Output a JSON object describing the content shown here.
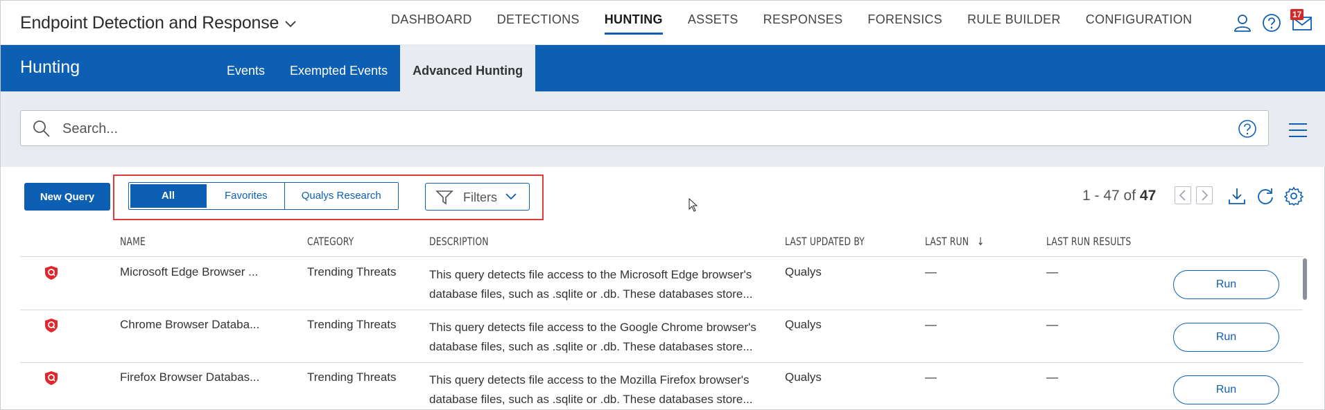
{
  "app": {
    "title": "Endpoint Detection and Response"
  },
  "nav": [
    {
      "label": "DASHBOARD",
      "active": false
    },
    {
      "label": "DETECTIONS",
      "active": false
    },
    {
      "label": "HUNTING",
      "active": true
    },
    {
      "label": "ASSETS",
      "active": false
    },
    {
      "label": "RESPONSES",
      "active": false
    },
    {
      "label": "FORENSICS",
      "active": false
    },
    {
      "label": "RULE BUILDER",
      "active": false
    },
    {
      "label": "CONFIGURATION",
      "active": false
    }
  ],
  "header_icons": {
    "user": "user-icon",
    "help": "help-icon",
    "mail": "mail-icon",
    "mail_badge": "17"
  },
  "section": {
    "title": "Hunting"
  },
  "subtabs": [
    {
      "label": "Events",
      "active": false
    },
    {
      "label": "Exempted Events",
      "active": false
    },
    {
      "label": "Advanced Hunting",
      "active": true
    }
  ],
  "search": {
    "placeholder": "Search...",
    "value": ""
  },
  "toolbar": {
    "new_query_label": "New Query",
    "segments": [
      {
        "label": "All",
        "active": true
      },
      {
        "label": "Favorites",
        "active": false
      },
      {
        "label": "Qualys Research",
        "active": false
      }
    ],
    "filters_label": "Filters"
  },
  "pagination": {
    "range": "1 - 47 of",
    "total": "47"
  },
  "table": {
    "headers": {
      "name": "NAME",
      "category": "CATEGORY",
      "description": "DESCRIPTION",
      "last_updated_by": "LAST UPDATED BY",
      "last_run": "LAST RUN",
      "last_run_results": "LAST RUN RESULTS"
    },
    "sort_indicator": "↓",
    "rows": [
      {
        "name": "Microsoft Edge Browser ...",
        "category": "Trending Threats",
        "desc1": "This query detects file access to the Microsoft Edge browser's",
        "desc2": "database files, such as .sqlite or .db. These databases store...",
        "last_updated_by": "Qualys",
        "last_run": "—",
        "last_run_results": "—",
        "action": "Run"
      },
      {
        "name": "Chrome Browser Databa...",
        "category": "Trending Threats",
        "desc1": "This query detects file access to the Google Chrome browser's",
        "desc2": "database files, such as .sqlite or .db. These databases store...",
        "last_updated_by": "Qualys",
        "last_run": "—",
        "last_run_results": "—",
        "action": "Run"
      },
      {
        "name": "Firefox Browser Databas...",
        "category": "Trending Threats",
        "desc1": "This query detects file access to the Mozilla Firefox browser's",
        "desc2": "database files, such as .sqlite or .db. These databases store...",
        "last_updated_by": "Qualys",
        "last_run": "—",
        "last_run_results": "—",
        "action": "Run"
      }
    ]
  },
  "colors": {
    "brand_blue": "#0d5fb3",
    "highlight_red": "#e03a3a",
    "qualys_red": "#e1262d"
  }
}
